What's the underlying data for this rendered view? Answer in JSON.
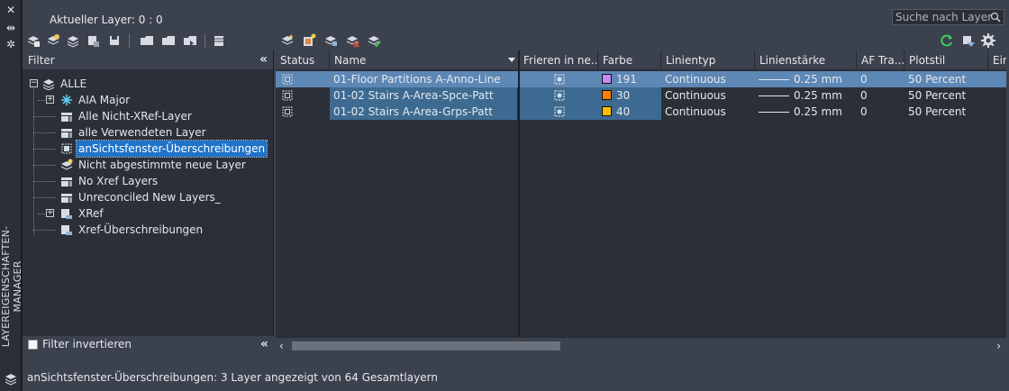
{
  "palette_title": "LAYEREIGENSCHAFTEN-MANAGER",
  "current_layer": "Aktueller Layer: 0 : 0",
  "search": {
    "placeholder": "Suche nach Layer"
  },
  "filter": {
    "title": "Filter",
    "tree": [
      {
        "label": "ALLE",
        "icon": "layer-stack-icon",
        "level": 0,
        "expander": "minus"
      },
      {
        "label": "AIA Major",
        "icon": "snowflake-filter-icon",
        "level": 1,
        "expander": "plus"
      },
      {
        "label": "Alle Nicht-XRef-Layer",
        "icon": "property-filter-icon",
        "level": 1
      },
      {
        "label": "alle Verwendeten Layer",
        "icon": "property-filter-icon",
        "level": 1
      },
      {
        "label": "anSichtsfenster-Überschreibungen",
        "icon": "viewport-override-icon",
        "level": 1,
        "selected": true
      },
      {
        "label": "Nicht abgestimmte neue Layer",
        "icon": "unreconciled-layer-icon",
        "level": 1
      },
      {
        "label": "No Xref Layers",
        "icon": "property-filter-icon",
        "level": 1
      },
      {
        "label": "Unreconciled New Layers_",
        "icon": "property-filter-icon",
        "level": 1
      },
      {
        "label": "XRef",
        "icon": "xref-filter-icon",
        "level": 1,
        "expander": "plus"
      },
      {
        "label": "Xref-Überschreibungen",
        "icon": "xref-override-icon",
        "level": 1
      }
    ],
    "invert_label": "Filter invertieren"
  },
  "grid": {
    "columns": [
      "Status",
      "Name",
      "Frieren in ne...",
      "Farbe",
      "Linientyp",
      "Linienstärke",
      "AF Tra...",
      "Plotstil",
      "Ein"
    ],
    "rows": [
      {
        "name": "01-Floor Partitions A-Anno-Line",
        "color_index": "191",
        "color_hex": "#c58af0",
        "linetype": "Continuous",
        "lineweight": "0.25 mm",
        "transparency": "0",
        "plotstyle": "50 Percent",
        "selected": true
      },
      {
        "name": "01-02 Stairs A-Area-Spce-Patt",
        "color_index": "30",
        "color_hex": "#ff7f00",
        "linetype": "Continuous",
        "lineweight": "0.25 mm",
        "transparency": "0",
        "plotstyle": "50 Percent",
        "selected": false
      },
      {
        "name": "01-02 Stairs A-Area-Grps-Patt",
        "color_index": "40",
        "color_hex": "#ffbf00",
        "linetype": "Continuous",
        "lineweight": "0.25 mm",
        "transparency": "0",
        "plotstyle": "50 Percent",
        "selected": false
      }
    ]
  },
  "status_text": "anSichtsfenster-Überschreibungen: 3 Layer angezeigt von 64 Gesamtlayern"
}
